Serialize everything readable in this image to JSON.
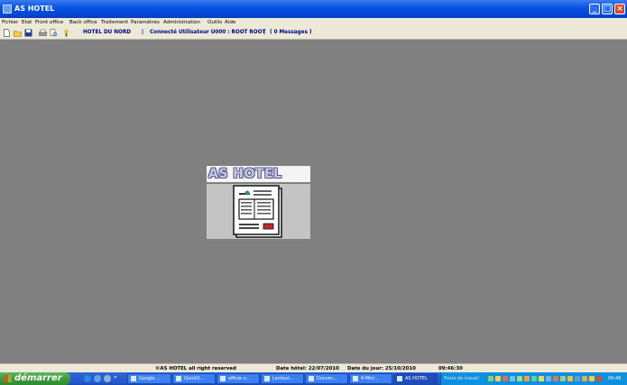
{
  "window": {
    "title": "AS HOTEL"
  },
  "menu": {
    "items": [
      "Fichier",
      "Etat",
      "Front office",
      "Back office",
      "Traitement",
      "Paramètres",
      "Administration",
      "Outils",
      "Aide"
    ]
  },
  "toolbar": {
    "hotel": "HOTEL DU NORD",
    "sep1": "|",
    "user": "Connecté Utilisateur U000 : ROOT  ROOT",
    "sep2": "|",
    "messages": "( 0 Messages )"
  },
  "splash": {
    "title": "AS HOTEL"
  },
  "statusbar": {
    "copyright": "©AS HOTEL all right reserved",
    "hotel_date": "Date hôtel: 22/07/2010",
    "today": "Date du jour: 25/10/2010",
    "time": "09:46:30"
  },
  "taskbar": {
    "start": "démarrer",
    "overflow": "»",
    "tasks": [
      "Google ...",
      "QuickS...",
      "eMule v...",
      "Lecteur...",
      "Docum...",
      "4 Micr...",
      "AS HOTEL"
    ],
    "tray_label": "Poste de travail",
    "clock": "09:46"
  },
  "colors": {
    "desktop": "#808080",
    "titlebar": "#0a55e2",
    "menubar": "#ece9d8",
    "toolbar_text": "#000080",
    "taskbar": "#245ad0",
    "start": "#3c9b3c"
  }
}
